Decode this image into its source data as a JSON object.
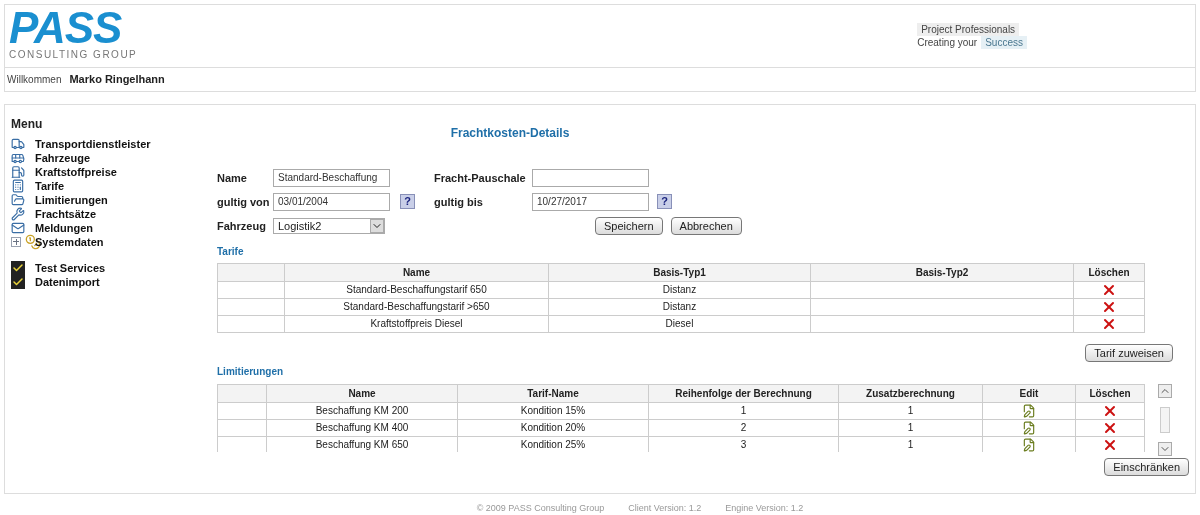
{
  "logo": {
    "text": "PASS",
    "subtitle": "CONSULTING GROUP"
  },
  "tagline": {
    "line1": "Project Professionals",
    "line2": "Creating your",
    "highlight": "Success"
  },
  "welcome": {
    "label": "Willkommen",
    "user": "Marko Ringelhann"
  },
  "menu": {
    "title": "Menu",
    "groups": [
      [
        {
          "label": "Transportdienstleister",
          "kind": "link"
        },
        {
          "label": "Fahrzeuge",
          "kind": "link"
        },
        {
          "label": "Kraftstoffpreise",
          "kind": "link"
        },
        {
          "label": "Tarife",
          "kind": "link"
        },
        {
          "label": "Limitierungen",
          "kind": "link"
        },
        {
          "label": "Frachtsätze",
          "kind": "link"
        },
        {
          "label": "Meldungen",
          "kind": "link"
        },
        {
          "label": "Systemdaten",
          "kind": "folder",
          "expanded": false
        }
      ],
      [
        {
          "label": "Test Services",
          "kind": "service"
        },
        {
          "label": "Datenimport",
          "kind": "service"
        }
      ]
    ]
  },
  "page_title": "Frachtkosten-Details",
  "form": {
    "name": {
      "label": "Name",
      "value": "Standard-Beschaffung"
    },
    "fracht_pauschale": {
      "label": "Fracht-Pauschale"
    },
    "gultig_von": {
      "label": "gultig von",
      "value": "03/01/2004",
      "help": "?"
    },
    "gultig_bis": {
      "label": "gultig bis",
      "value": "10/27/2017",
      "help": "?"
    },
    "fahrzeug": {
      "label": "Fahrzeug",
      "value": "Logistik2"
    },
    "buttons": [
      "Speichern",
      "Abbrechen"
    ]
  },
  "tarife": {
    "title": "Tarife",
    "columns": [
      "Name",
      "Basis-Typ1",
      "Basis-Typ2",
      "Löschen"
    ],
    "rows": [
      {
        "name": "Standard-Beschaffungstarif 650",
        "basis_typ1": "Distanz"
      },
      {
        "name": "Standard-Beschaffungstarif >650",
        "basis_typ1": "Distanz"
      },
      {
        "name": "Kraftstoffpreis Diesel",
        "basis_typ1": "Diesel"
      }
    ],
    "button": "Tarif zuweisen"
  },
  "limitierungen": {
    "title": "Limitierungen",
    "columns": [
      "Name",
      "Tarif-Name",
      "Reihenfolge der Berechnung",
      "Zusatzberechnung",
      "Edit",
      "Löschen"
    ],
    "rows": [
      {
        "name": "Beschaffung KM 200",
        "tarif_name": "Kondition 15%",
        "reihenfolge": "1",
        "zusatz": "1"
      },
      {
        "name": "Beschaffung KM 400",
        "tarif_name": "Kondition 20%",
        "reihenfolge": "2",
        "zusatz": "1"
      },
      {
        "name": "Beschaffung KM 650",
        "tarif_name": "Kondition 25%",
        "reihenfolge": "3",
        "zusatz": "1"
      }
    ],
    "button": "Einschränken"
  },
  "footer": [
    "© 2009  PASS Consulting Group",
    "Client Version: 1.2",
    "Engine Version: 1.2"
  ]
}
